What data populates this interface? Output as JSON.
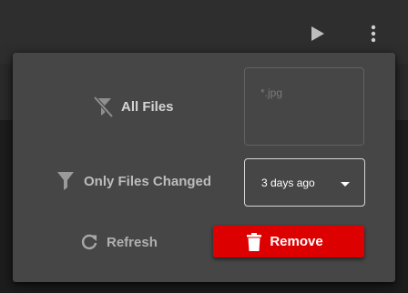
{
  "toolbar": {
    "play_icon": "play-icon",
    "more_icon": "more-vert-icon"
  },
  "menu": {
    "all_files": {
      "label": "All Files",
      "icon": "filter-off-icon"
    },
    "pattern_field": {
      "placeholder": "*.jpg",
      "value": ""
    },
    "only_changed": {
      "label": "Only Files Changed",
      "icon": "filter-icon"
    },
    "date_select": {
      "selected": "3 days ago",
      "icon": "caret-down-icon"
    },
    "refresh": {
      "label": "Refresh",
      "icon": "refresh-icon"
    },
    "remove": {
      "label": "Remove",
      "icon": "trash-icon"
    }
  },
  "colors": {
    "panel_bg": "#464646",
    "topbar_bg": "#2e2e2e",
    "remove_bg": "#dd0000",
    "text_muted": "#b8b8b8"
  }
}
